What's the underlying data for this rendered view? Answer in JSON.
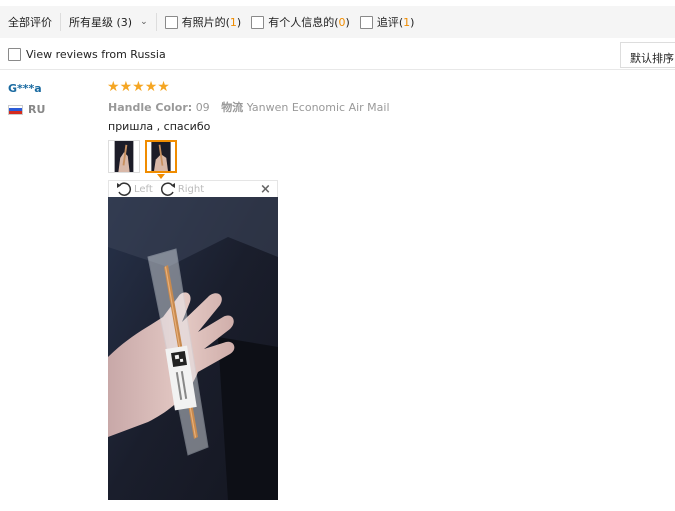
{
  "filters": {
    "all_label": "全部评价",
    "stars_label": "所有星级 (3)",
    "with_photos_label": "有照片的",
    "with_photos_count": "1",
    "with_personal_info_label": "有个人信息的",
    "with_personal_info_count": "0",
    "additional_label": "追评",
    "additional_count": "1",
    "open_paren": "(",
    "close_paren": ")"
  },
  "region_filter": {
    "label": "View reviews from Russia",
    "sort_label": "默认排序"
  },
  "review": {
    "user_name": "G***a",
    "country_code": "RU",
    "rating": 5,
    "handle_color_label": "Handle Color:",
    "handle_color_value": "09",
    "shipping_label": "物流",
    "shipping_value": "Yanwen Economic Air Mail",
    "text": "пришла , спасибо"
  },
  "viewer": {
    "left_label": "Left",
    "right_label": "Right",
    "close_glyph": "×"
  },
  "icons": {
    "star": "star-icon",
    "rotate_left": "rotate-left-icon",
    "rotate_right": "rotate-right-icon",
    "close": "close-icon",
    "chevron": "chevron-down-icon"
  },
  "colors": {
    "accent": "#f08c00",
    "star": "#f5a623",
    "username": "#1a6aa0"
  }
}
